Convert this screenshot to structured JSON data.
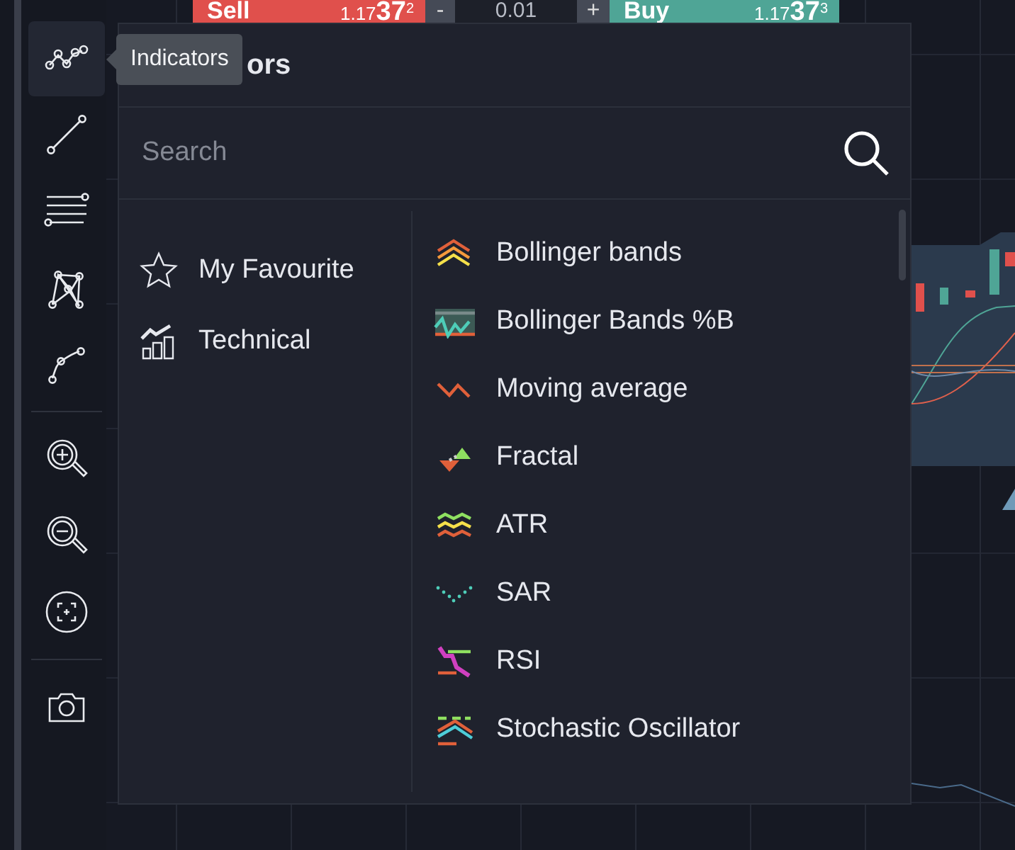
{
  "toolbar": {
    "groups": [
      [
        {
          "selected": true
        },
        {
          "selected": false
        },
        {
          "selected": false
        },
        {
          "selected": false
        },
        {
          "selected": false
        }
      ],
      [
        {
          "selected": false
        },
        {
          "selected": false
        },
        {
          "selected": false
        }
      ],
      [
        {
          "selected": false
        }
      ]
    ]
  },
  "tooltip": {
    "text": "Indicators"
  },
  "trade_bar": {
    "sell": {
      "label": "Sell",
      "price": "1.17**37**$^{2}$"
    },
    "decrement": "-",
    "lot": "0.01",
    "increment": "+",
    "buy": {
      "label": "Buy",
      "price": "1.17**37**$^{3}$"
    }
  },
  "panel": {
    "title": "ors",
    "search": {
      "placeholder": "Search"
    },
    "categories": [
      {
        "label": "My Favourite"
      },
      {
        "label": "Technical"
      }
    ],
    "indicators": [
      {
        "label": "Bollinger bands"
      },
      {
        "label": "Bollinger Bands %B"
      },
      {
        "label": "Moving average"
      },
      {
        "label": "Fractal"
      },
      {
        "label": "ATR"
      },
      {
        "label": "SAR"
      },
      {
        "label": "RSI"
      },
      {
        "label": "Stochastic Oscillator"
      }
    ]
  }
}
